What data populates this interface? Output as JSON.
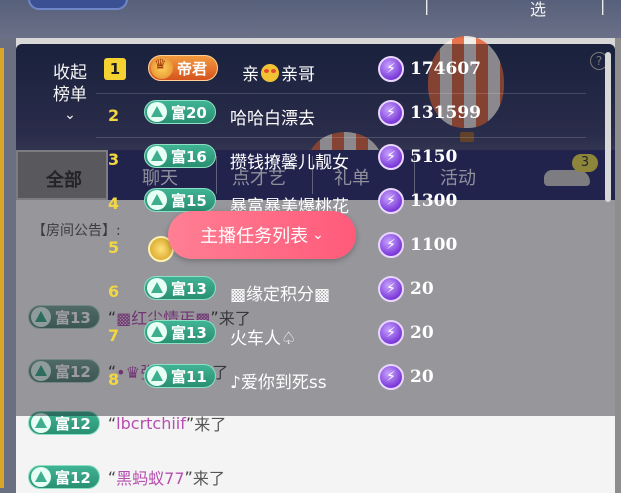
{
  "top": {
    "text_right_1": "|",
    "text_right_2": "选",
    "text_right_3": "|"
  },
  "tabs": {
    "all": "全部",
    "items": [
      "聊天",
      "点才艺",
      "礼单",
      "活动"
    ],
    "car_count": "3"
  },
  "chat": {
    "notice": "【房间公告】:",
    "messages": [
      {
        "badge": "富13",
        "open_quote": "“",
        "name": "▩红尘情丐▩",
        "close_quote": "”",
        "tail": "来了"
      },
      {
        "badge": "富12",
        "open_quote": "“",
        "name": "•♛张努力",
        "close_quote": "”",
        "tail": "来了"
      },
      {
        "badge": "富12",
        "open_quote": "“",
        "name": "lbcrtchiif",
        "close_quote": "”",
        "tail": "来了"
      },
      {
        "badge": "富12",
        "open_quote": "“",
        "name": "黑蚂蚁77",
        "close_quote": "”",
        "tail": "来了"
      }
    ]
  },
  "leaderboard": {
    "collapse_label_1": "收起",
    "collapse_label_2": "榜单",
    "help_icon": "?",
    "rows": [
      {
        "rank": "1",
        "badge": "帝君",
        "name": "亲",
        "name_suffix": "亲哥",
        "score": "174607"
      },
      {
        "rank": "2",
        "badge": "富20",
        "name": "哈哈白漂去",
        "score": "131599"
      },
      {
        "rank": "3",
        "badge": "富16",
        "name": "攒钱撩馨儿靓女",
        "score": "5150"
      },
      {
        "rank": "4",
        "badge": "富15",
        "name": "暴富暴美爆桃花",
        "score": "1300"
      },
      {
        "rank": "5",
        "badge": "",
        "name": "",
        "score": "1100"
      },
      {
        "rank": "6",
        "badge": "富13",
        "name": "▩缘定积分▩",
        "score": "20"
      },
      {
        "rank": "7",
        "badge": "富13",
        "name": "火车人♤",
        "score": "20"
      },
      {
        "rank": "8",
        "badge": "富11",
        "name": "♪爱你到死ss",
        "score": "20"
      }
    ]
  },
  "task_button": {
    "label": "主播任务列表"
  },
  "colors": {
    "accent_pink": "#ff6a85",
    "wealth_green": "#3fb494",
    "score_gem": "#7a39d8",
    "rank_gold": "#f2d642"
  }
}
